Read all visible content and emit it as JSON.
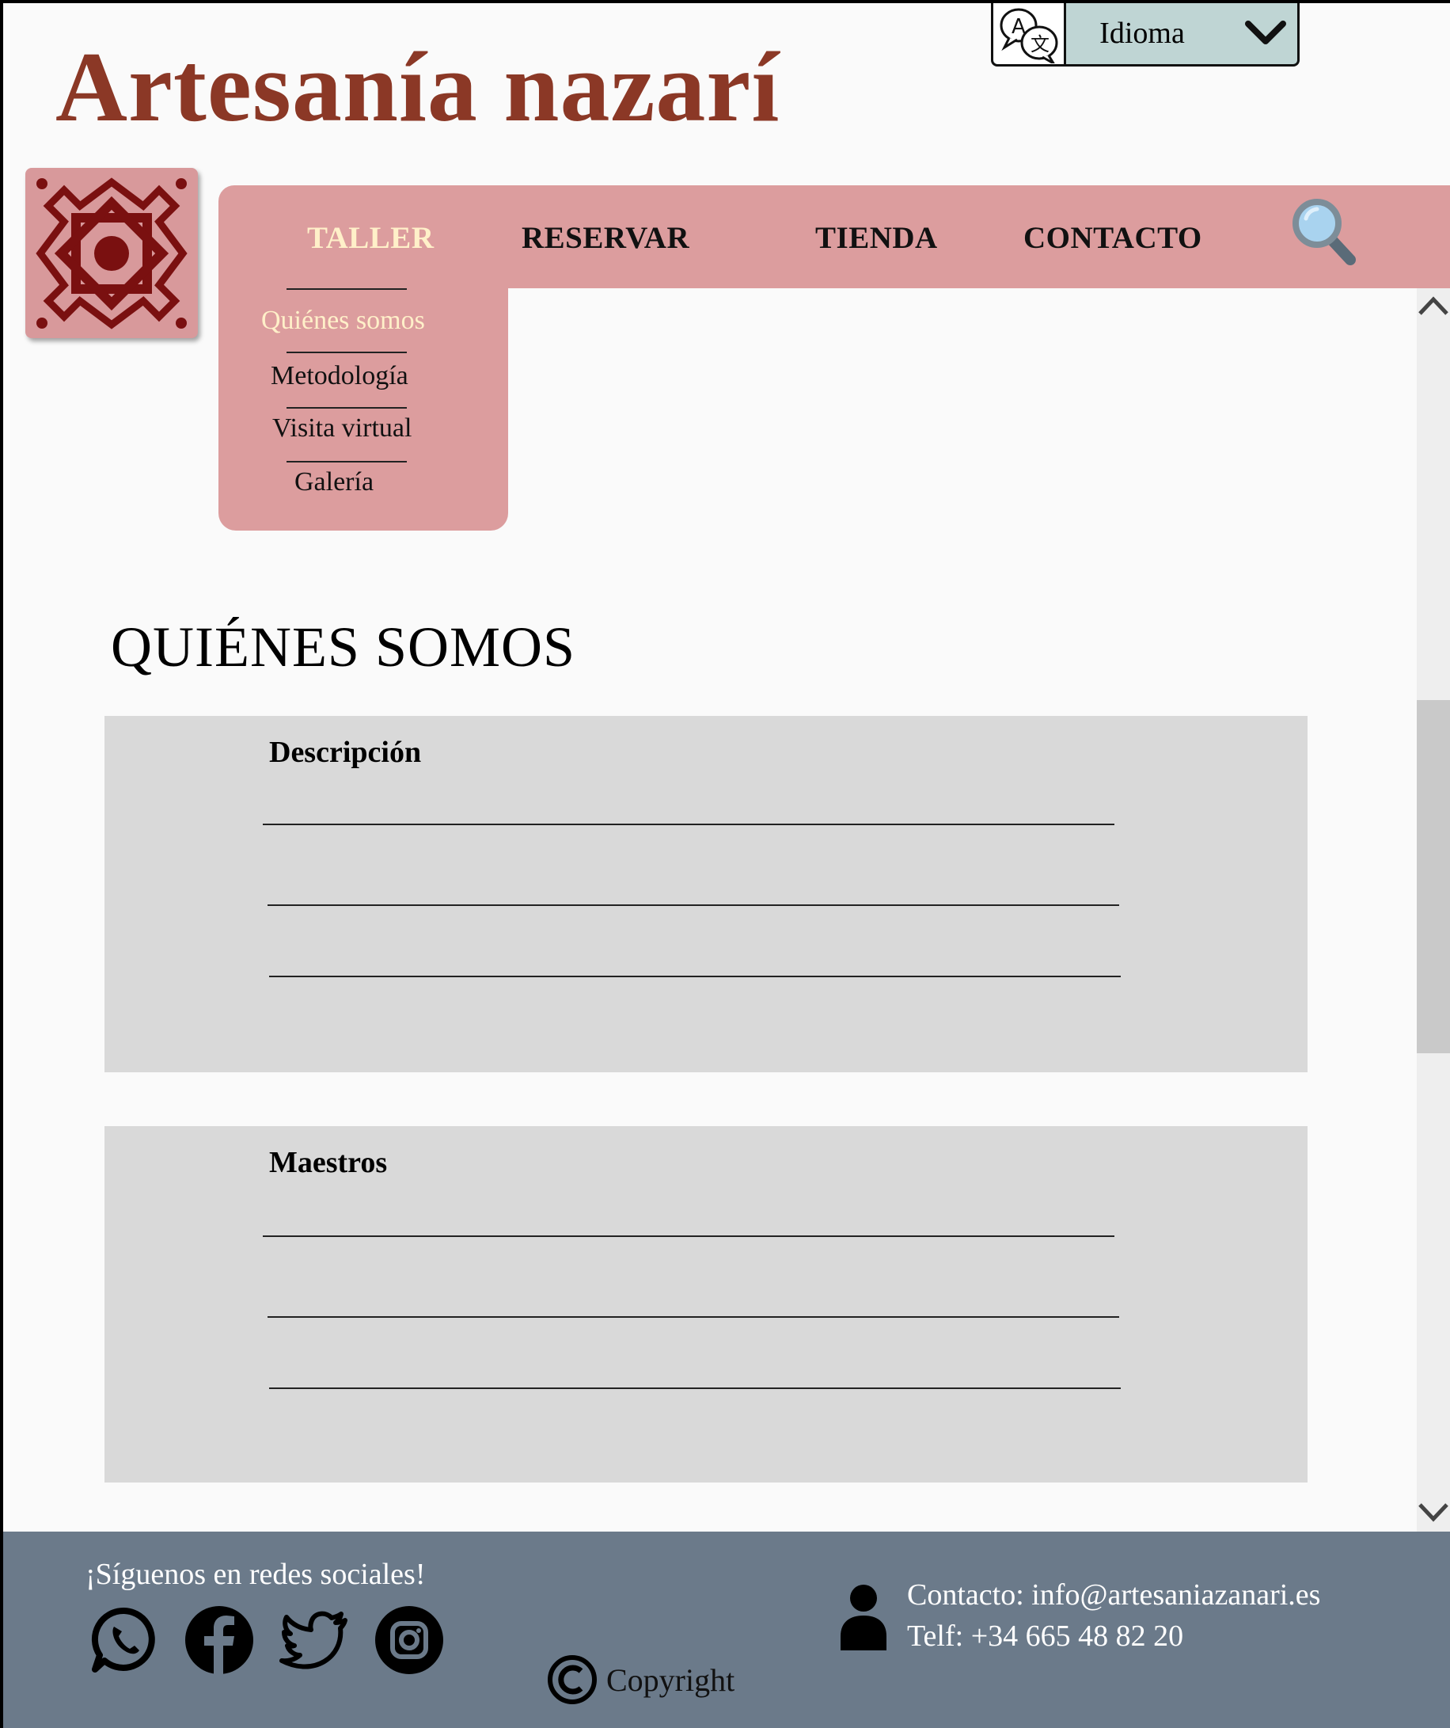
{
  "header": {
    "brand": "Artesanía nazarí",
    "language_label": "Idioma"
  },
  "nav": {
    "items": [
      {
        "label": "TALLER",
        "active": true
      },
      {
        "label": "RESERVAR",
        "active": false
      },
      {
        "label": "TIENDA",
        "active": false
      },
      {
        "label": "CONTACTO",
        "active": false
      }
    ],
    "submenu": [
      {
        "label": "Quiénes somos",
        "active": true
      },
      {
        "label": "Metodología",
        "active": false
      },
      {
        "label": "Visita virtual",
        "active": false
      },
      {
        "label": "Galería",
        "active": false
      }
    ]
  },
  "main": {
    "title": "QUIÉNES SOMOS",
    "cards": [
      {
        "title": "Descripción"
      },
      {
        "title": "Maestros"
      }
    ]
  },
  "footer": {
    "follow": "¡Síguenos en redes sociales!",
    "social": [
      "whatsapp-icon",
      "facebook-icon",
      "twitter-icon",
      "instagram-icon"
    ],
    "copyright": "Copyright",
    "contact_email": "Contacto: info@artesaniazanari.es",
    "contact_phone": "Telf: +34 665 48 82 20"
  },
  "colors": {
    "brand": "#8b3826",
    "nav_bg": "#dc9d9e",
    "active": "#fff0c9",
    "footer_bg": "#6b7a8a",
    "card_bg": "#d9d9d9"
  }
}
